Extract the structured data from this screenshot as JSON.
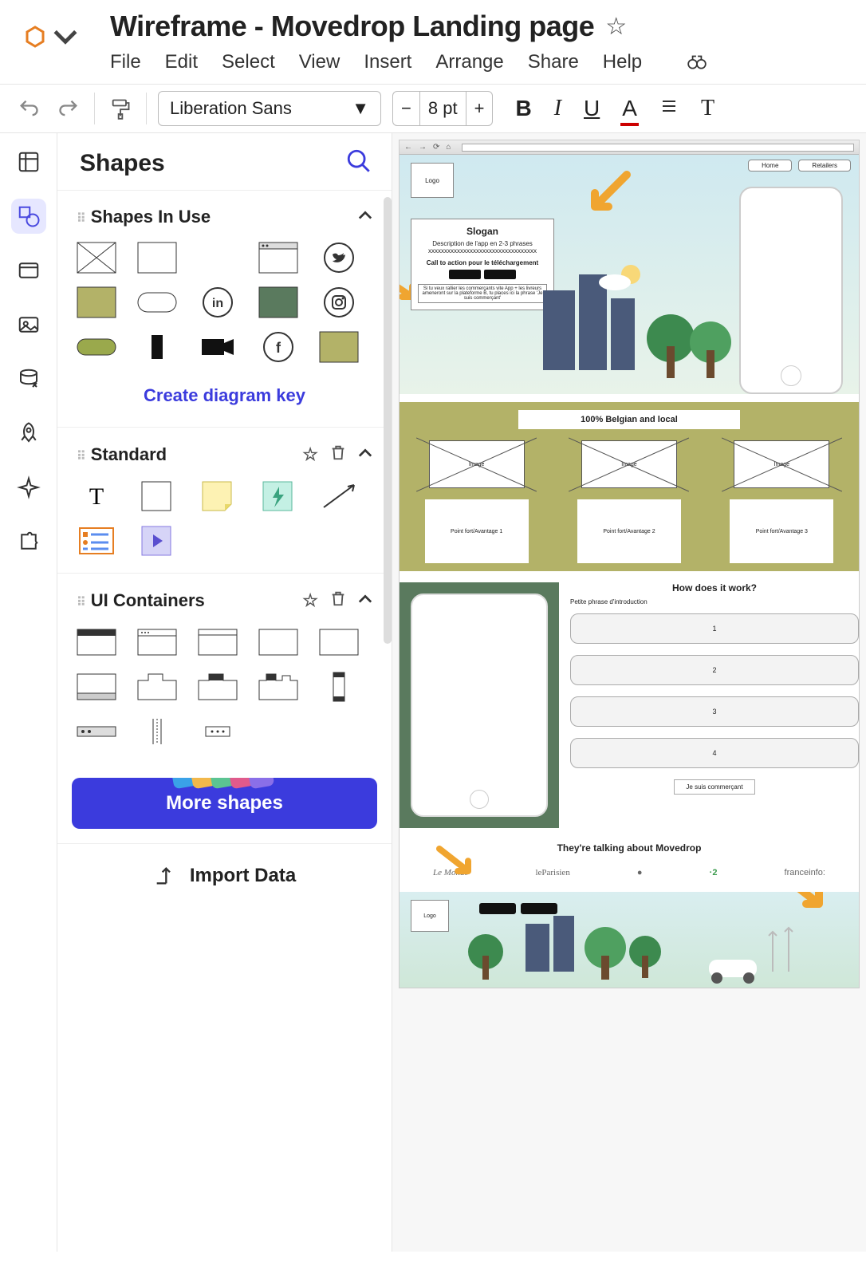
{
  "doc": {
    "title": "Wireframe - Movedrop Landing page"
  },
  "menu": {
    "file": "File",
    "edit": "Edit",
    "select": "Select",
    "view": "View",
    "insert": "Insert",
    "arrange": "Arrange",
    "share": "Share",
    "help": "Help"
  },
  "toolbar": {
    "font": "Liberation Sans",
    "size": "8",
    "unit": "pt",
    "minus": "−",
    "plus": "+",
    "b": "B",
    "i": "I",
    "u": "U",
    "a": "A",
    "t": "T"
  },
  "panel": {
    "title": "Shapes",
    "inuse": "Shapes In Use",
    "key": "Create diagram key",
    "standard": "Standard",
    "uicont": "UI Containers",
    "more": "More shapes",
    "import": "Import Data"
  },
  "wf": {
    "nav": {
      "home": "Home",
      "retailers": "Retailers"
    },
    "logo": "Logo",
    "slogan": "Slogan",
    "desc": "Description de l'app en 2-3 phrases xxxxxxxxxxxxxxxxxxxxxxxxxxxxxxxxxx",
    "cta": "Call to action pour le téléchargement",
    "belgian": "100% Belgian and local",
    "imglbl": "Image",
    "adv1": "Point fort/Avantage 1",
    "adv2": "Point fort/Avantage 2",
    "adv3": "Point fort/Avantage 3",
    "how": "How does it work?",
    "howsub": "Petite phrase d'introduction",
    "s1": "1",
    "s2": "2",
    "s3": "3",
    "s4": "4",
    "merchant": "Je suis commerçant",
    "press": "They're talking about Movedrop",
    "p1": "Le Monde",
    "p2": "leParisien",
    "p3": "●",
    "p4": "·2",
    "p5": "franceinfo:"
  }
}
